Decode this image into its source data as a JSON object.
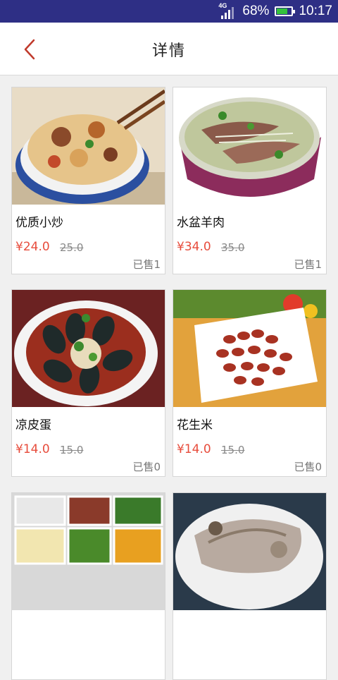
{
  "status_bar": {
    "network": "4G",
    "battery": "68%",
    "battery_level": 0.68,
    "time": "10:17"
  },
  "header": {
    "title": "详情",
    "back_icon": "chevron-left-icon",
    "accent": "#c0392b"
  },
  "currency": "¥",
  "items": [
    {
      "name": "优质小炒",
      "price": "¥24.0",
      "original_price": "25.0",
      "sold": "已售1",
      "image": "stir-fry-bowl"
    },
    {
      "name": "水盆羊肉",
      "price": "¥34.0",
      "original_price": "35.0",
      "sold": "已售1",
      "image": "mutton-soup"
    },
    {
      "name": "凉皮蛋",
      "price": "¥14.0",
      "original_price": "15.0",
      "sold": "已售0",
      "image": "century-eggs"
    },
    {
      "name": "花生米",
      "price": "¥14.0",
      "original_price": "15.0",
      "sold": "已售0",
      "image": "peanuts"
    },
    {
      "name": "",
      "price": "",
      "original_price": "",
      "sold": "",
      "image": "cold-dishes"
    },
    {
      "name": "",
      "price": "",
      "original_price": "",
      "sold": "",
      "image": "stewed-meat"
    }
  ],
  "colors": {
    "status_bar": "#2e2f85",
    "price": "#e74c3c"
  }
}
